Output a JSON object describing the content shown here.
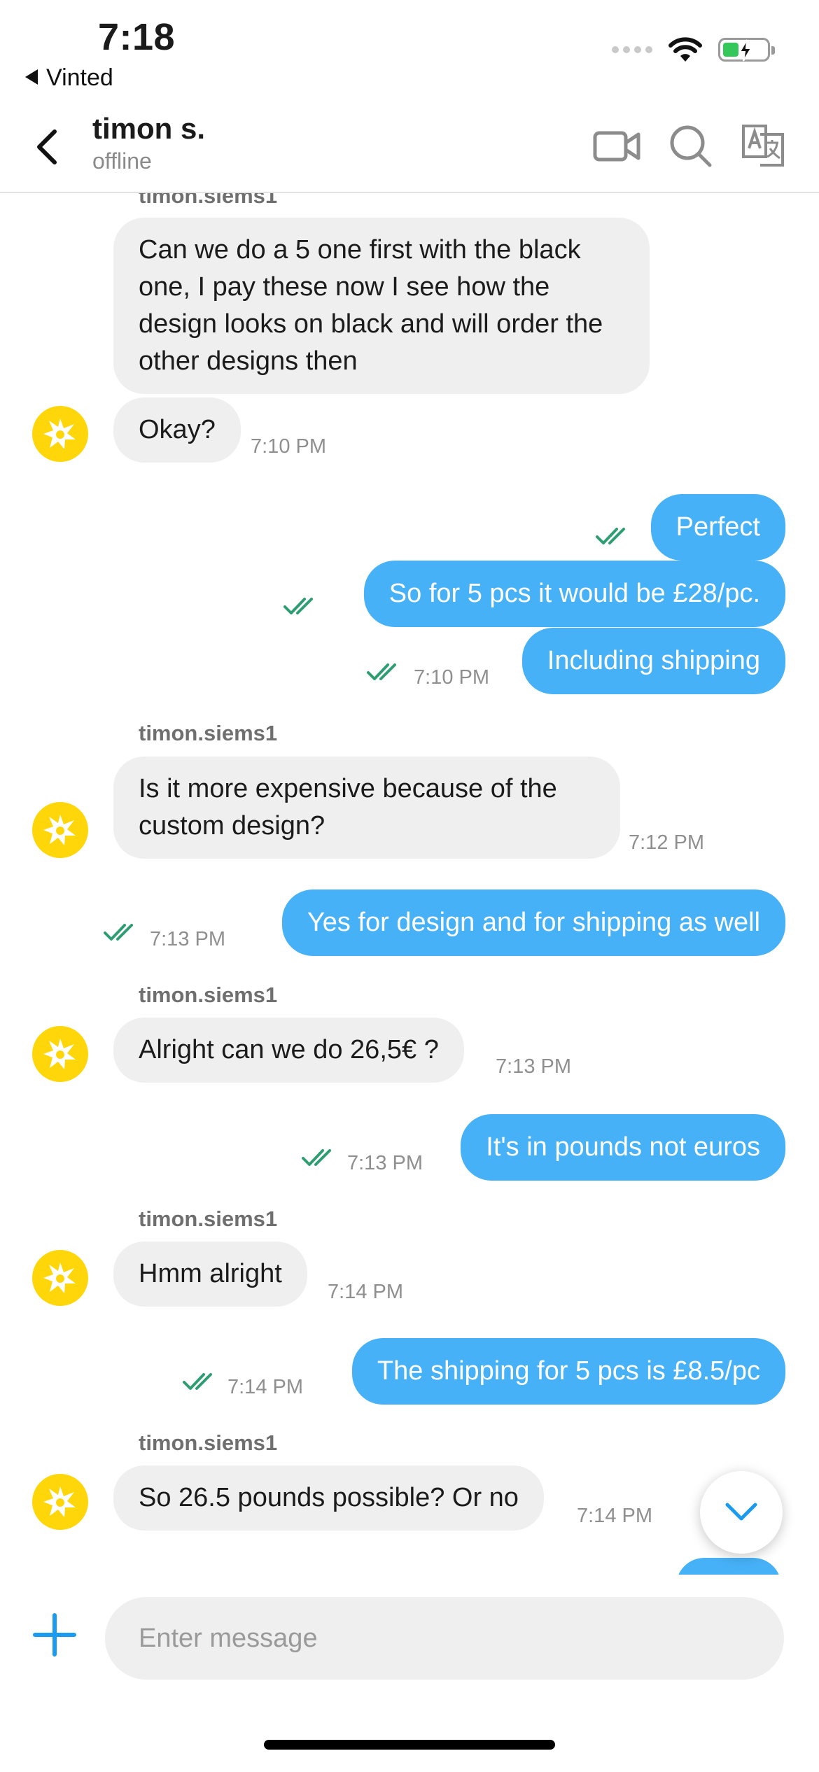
{
  "status_bar": {
    "time": "7:18",
    "back_app": "Vinted"
  },
  "header": {
    "name": "timon s.",
    "status": "offline"
  },
  "messages": [
    {
      "sender": "timon.siems1"
    },
    {
      "text": "Can we do a 5 one first with the black one, I pay these now I see how the design looks on black and will order the other designs  then"
    },
    {
      "text": "Okay?",
      "time": "7:10 PM"
    },
    {
      "text": "Perfect"
    },
    {
      "text": "So for 5 pcs it would be £28/pc."
    },
    {
      "text": "Including shipping",
      "time": "7:10 PM"
    },
    {
      "sender": "timon.siems1",
      "text": "Is it more expensive because of the custom design?",
      "time": "7:12 PM"
    },
    {
      "text": "Yes for design and for shipping as well",
      "time": "7:13 PM"
    },
    {
      "sender": "timon.siems1",
      "text": "Alright can we do 26,5€ ?",
      "time": "7:13 PM"
    },
    {
      "text": "It's in pounds not euros",
      "time": "7:13 PM"
    },
    {
      "sender": "timon.siems1",
      "text": "Hmm alright",
      "time": "7:14 PM"
    },
    {
      "text": "The shipping for 5 pcs is £8.5/pc",
      "time": "7:14 PM"
    },
    {
      "sender": "timon.siems1",
      "text": "So 26.5 pounds possible? Or no",
      "time": "7:14 PM"
    }
  ],
  "composer": {
    "placeholder": "Enter message"
  },
  "colors": {
    "outgoing_bubble": "#47b1f7",
    "incoming_bubble": "#efefef",
    "read_check": "#2e9e72",
    "avatar": "#ffd60a",
    "accent": "#1a9bf0"
  },
  "icons": [
    "back-arrow-icon",
    "video-call-icon",
    "search-icon",
    "translate-icon",
    "read-receipt-icon",
    "chevron-down-icon",
    "plus-icon",
    "wifi-icon",
    "battery-charging-icon"
  ]
}
